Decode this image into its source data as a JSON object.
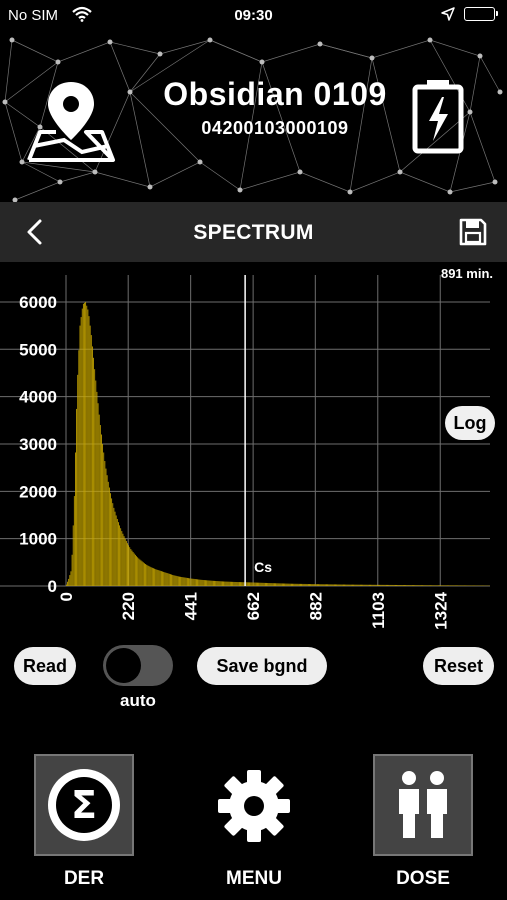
{
  "status_bar": {
    "carrier": "No SIM",
    "time": "09:30"
  },
  "device": {
    "name": "Obsidian 0109",
    "serial": "04200103000109"
  },
  "navbar": {
    "title": "SPECTRUM"
  },
  "spectrum": {
    "duration": "891 min.",
    "log_label": "Log",
    "marker_label": "Cs"
  },
  "controls": {
    "read_label": "Read",
    "auto_label": "auto",
    "auto_enabled": false,
    "save_bgnd_label": "Save bgnd",
    "reset_label": "Reset"
  },
  "tabs": {
    "der": "DER",
    "menu": "MENU",
    "dose": "DOSE"
  },
  "colors": {
    "bars": "#c9a800",
    "background": "#000000",
    "navbar": "#272727",
    "grid": "#6e6e6e"
  },
  "chart_data": {
    "type": "bar",
    "title": "",
    "xlabel": "",
    "ylabel": "",
    "x_ticks": [
      "0",
      "220",
      "441",
      "662",
      "882",
      "1103",
      "1324"
    ],
    "y_ticks": [
      "0",
      "1000",
      "2000",
      "3000",
      "4000",
      "5000",
      "6000"
    ],
    "xlim": [
      0,
      1500
    ],
    "ylim": [
      0,
      6400
    ],
    "marker": {
      "x": 662,
      "label": "Cs"
    },
    "x": [
      0,
      10,
      20,
      30,
      40,
      50,
      60,
      70,
      80,
      90,
      100,
      110,
      120,
      130,
      140,
      150,
      160,
      170,
      180,
      190,
      200,
      210,
      220,
      230,
      240,
      250,
      260,
      280,
      300,
      320,
      340,
      360,
      380,
      400,
      440,
      480,
      520,
      560,
      600,
      660,
      720,
      800,
      900,
      1000,
      1100,
      1200,
      1300,
      1400,
      1500
    ],
    "values": [
      0,
      150,
      350,
      1900,
      4200,
      5500,
      5950,
      6000,
      5800,
      5300,
      4700,
      4100,
      3500,
      3000,
      2550,
      2200,
      1900,
      1650,
      1450,
      1280,
      1130,
      1000,
      880,
      780,
      700,
      630,
      570,
      470,
      400,
      350,
      310,
      270,
      230,
      200,
      160,
      130,
      110,
      95,
      85,
      75,
      62,
      48,
      38,
      30,
      25,
      20,
      15,
      12,
      8
    ]
  }
}
